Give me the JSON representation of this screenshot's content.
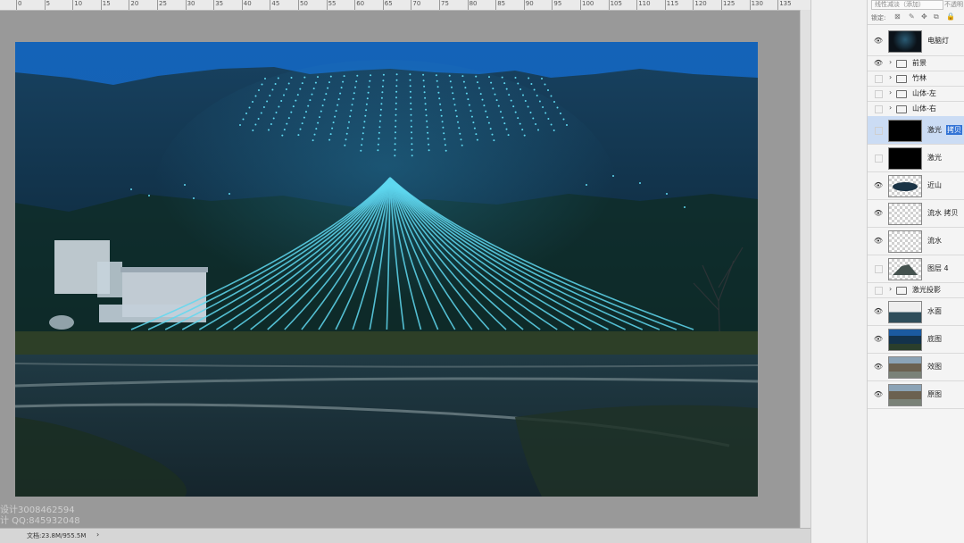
{
  "ruler": {
    "ticks": [
      "0",
      "5",
      "10",
      "15",
      "20",
      "25",
      "30",
      "35",
      "40",
      "45",
      "50",
      "55",
      "60",
      "65",
      "70",
      "75",
      "80",
      "85",
      "90",
      "95",
      "100",
      "105",
      "110",
      "115",
      "120",
      "125",
      "130",
      "135"
    ]
  },
  "watermark": {
    "line1": "设计3008462594",
    "line2": "计 QQ:845932048"
  },
  "statusbar": {
    "doc": "文档:23.8M/955.5M",
    "arrow": "›"
  },
  "layers_panel": {
    "blend_mode": "线性减淡（添加）",
    "opacity_label": "不透明",
    "lock_label": "锁定:",
    "layers": [
      {
        "name": "电脑灯",
        "visible": true,
        "thumb": "dark-lights"
      },
      {
        "name": "前景",
        "visible": true,
        "group": true
      },
      {
        "name": "竹林",
        "visible": false,
        "group": true
      },
      {
        "name": "山体-左",
        "visible": false,
        "group": true
      },
      {
        "name": "山体-右",
        "visible": false,
        "group": true
      },
      {
        "name": "激光",
        "visible": false,
        "thumb": "black",
        "selected": true,
        "edit_text": "拷贝"
      },
      {
        "name": "激光",
        "visible": false,
        "thumb": "black"
      },
      {
        "name": "近山",
        "visible": true,
        "thumb": "mountain"
      },
      {
        "name": "流水 拷贝",
        "visible": true,
        "thumb": "transparent"
      },
      {
        "name": "流水",
        "visible": true,
        "thumb": "transparent"
      },
      {
        "name": "图层 4",
        "visible": false,
        "thumb": "hill"
      },
      {
        "name": "激光投影",
        "visible": false,
        "group": true
      },
      {
        "name": "水面",
        "visible": true,
        "thumb": "water"
      },
      {
        "name": "底图",
        "visible": true,
        "thumb": "night"
      },
      {
        "name": "效图",
        "visible": true,
        "thumb": "photo"
      },
      {
        "name": "原图",
        "visible": true,
        "thumb": "photo"
      }
    ]
  },
  "colors": {
    "sky": "#1a5fa8",
    "mountain": "#13324b",
    "laser": "#5fd8f0",
    "selection": "#cbdcf4"
  }
}
